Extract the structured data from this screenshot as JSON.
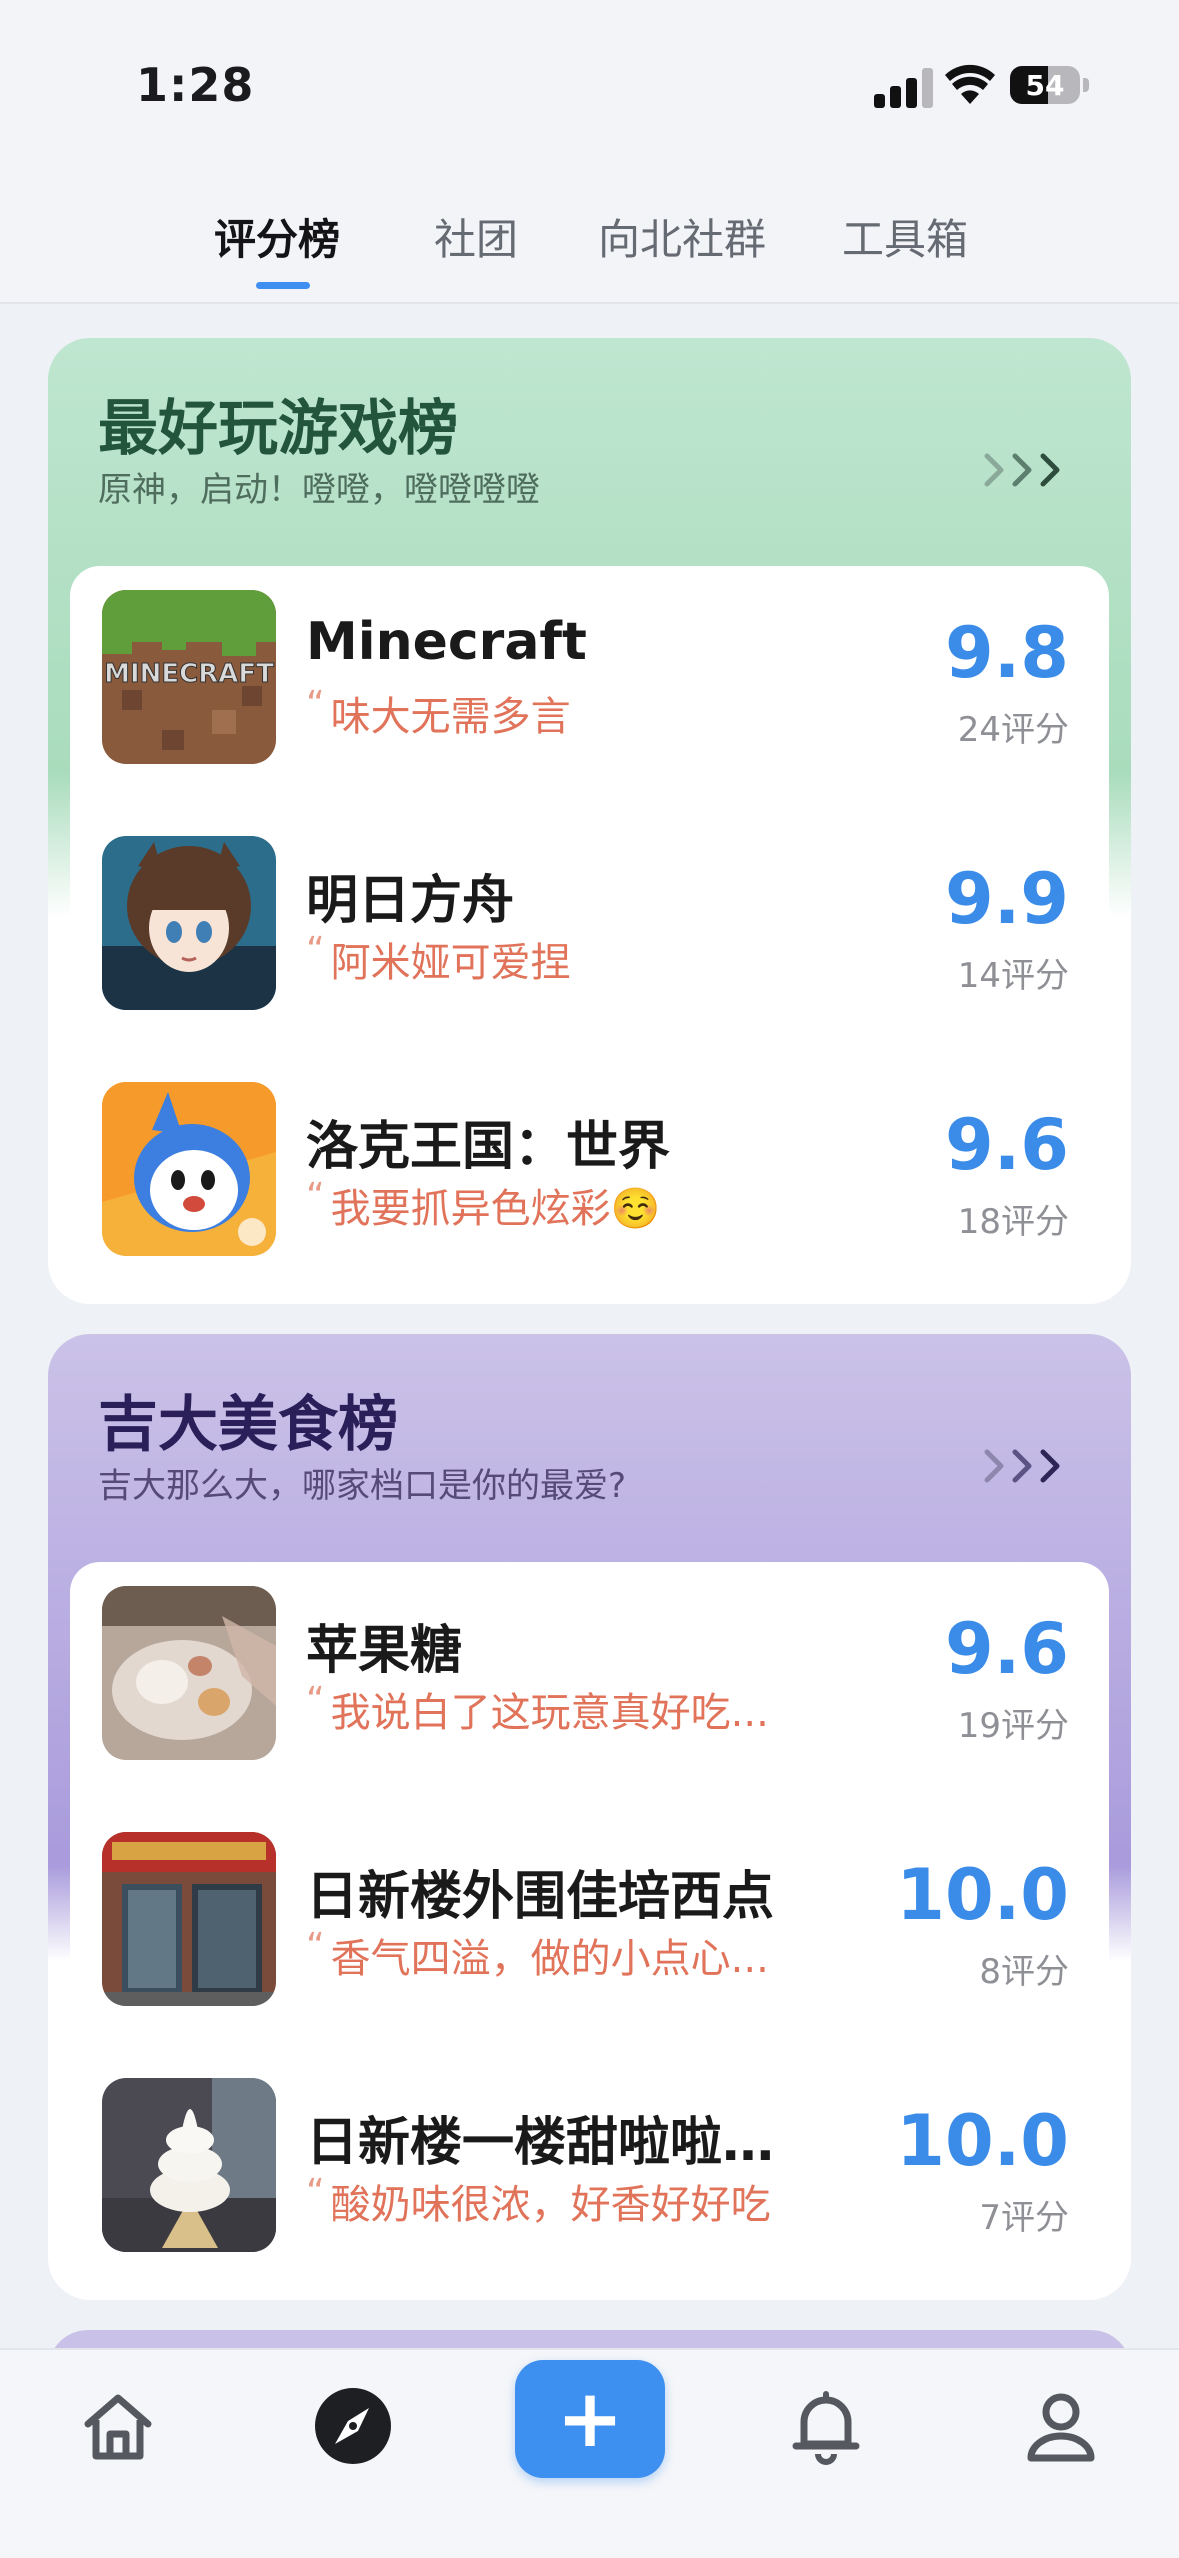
{
  "status_bar": {
    "time": "1:28",
    "battery": "54",
    "battery_level": 0.54
  },
  "tabs": [
    {
      "label": "评分榜",
      "active": true
    },
    {
      "label": "社团",
      "active": false
    },
    {
      "label": "向北社群",
      "active": false
    },
    {
      "label": "工具箱",
      "active": false
    }
  ],
  "cards": [
    {
      "title": "最好玩游戏榜",
      "subtitle": "原神，启动！噔噔，噔噔噔噔",
      "accent": "#a9dcbc",
      "items": [
        {
          "name": "Minecraft",
          "quote": "味大无需多言",
          "score": "9.8",
          "count": "24评分",
          "thumb": "minecraft-grass-block",
          "thumb_text": "MINECRAFT"
        },
        {
          "name": "明日方舟",
          "quote": "阿米娅可爱捏",
          "score": "9.9",
          "count": "14评分",
          "thumb": "anime-girl-avatar"
        },
        {
          "name": "洛克王国：世界",
          "quote": "我要抓异色炫彩☺️",
          "score": "9.6",
          "count": "18评分",
          "thumb": "blue-mascot-avatar"
        }
      ]
    },
    {
      "title": "吉大美食榜",
      "subtitle": "吉大那么大，哪家档口是你的最爱?",
      "accent": "#a99bdc",
      "items": [
        {
          "name": "苹果糖",
          "quote": "我说白了这玩意真好吃...",
          "score": "9.6",
          "count": "19评分",
          "thumb": "candy-apple-photo"
        },
        {
          "name": "日新楼外围佳培西点",
          "quote": "香气四溢，做的小点心...",
          "score": "10.0",
          "count": "8评分",
          "thumb": "bakery-storefront-photo"
        },
        {
          "name": "日新楼一楼甜啦啦酸...",
          "quote": "酸奶味很浓，好香好好吃",
          "score": "10.0",
          "count": "7评分",
          "thumb": "soft-serve-icecream-photo"
        }
      ]
    }
  ],
  "bottom_nav": {
    "items": [
      "home-icon",
      "compass-icon",
      "plus-icon",
      "bell-icon",
      "profile-icon"
    ],
    "plus_label": "+"
  },
  "colors": {
    "primary": "#3d8ff0",
    "quote": "#e0735a"
  }
}
